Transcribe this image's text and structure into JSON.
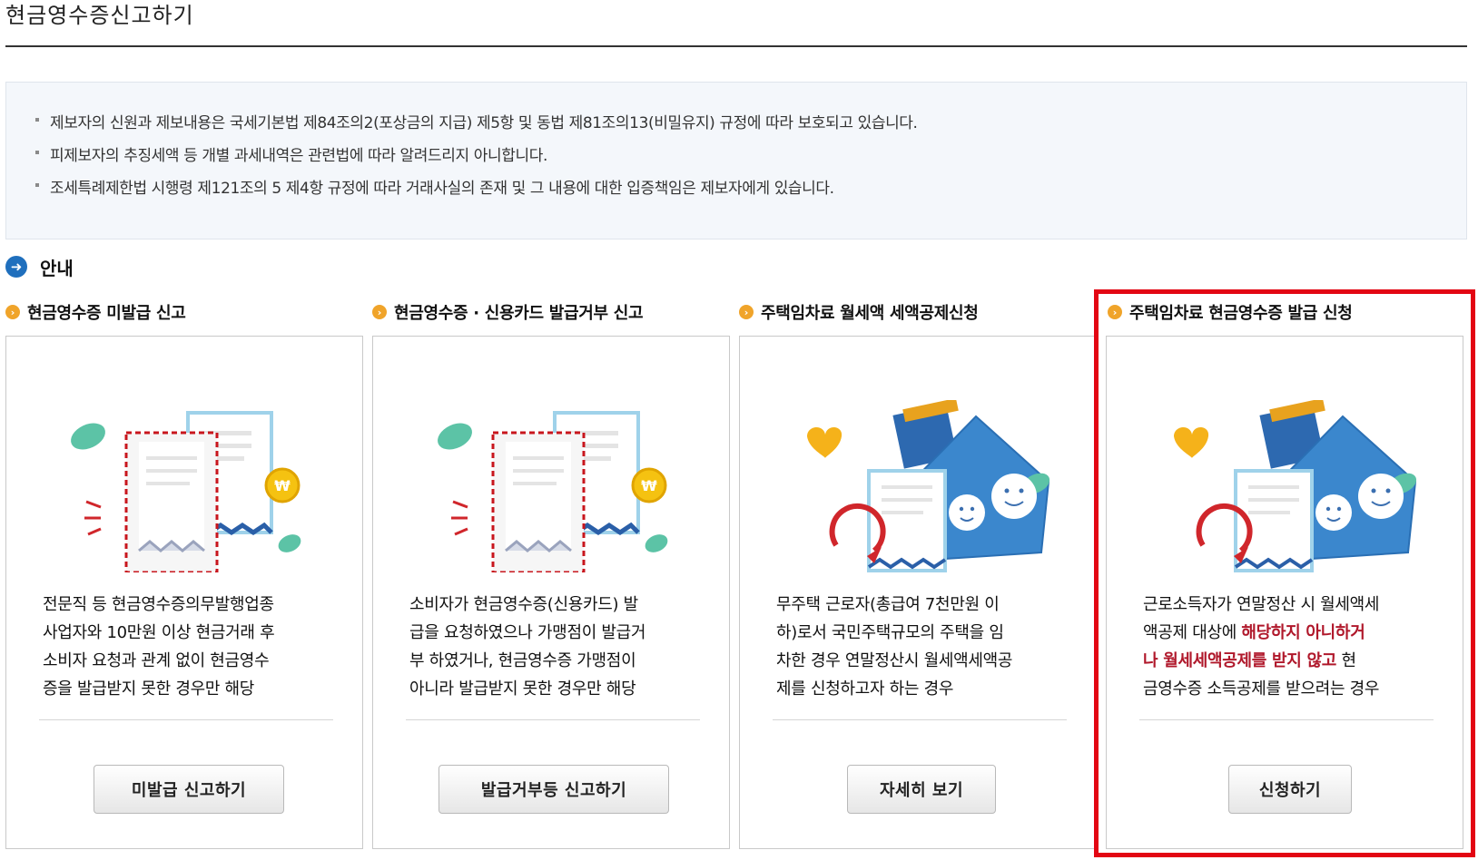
{
  "page": {
    "title": "현금영수증신고하기"
  },
  "notices": [
    "제보자의 신원과 제보내용은 국세기본법 제84조의2(포상금의 지급) 제5항 및 동법 제81조의13(비밀유지) 규정에 따라 보호되고 있습니다.",
    "피제보자의 추징세액 등 개별 과세내역은 관련법에 따라 알려드리지 아니합니다.",
    "조세특례제한법 시행령 제121조의 5 제4항 규정에 따라 거래사실의 존재 및 그 내용에 대한 입증책임은 제보자에게 있습니다."
  ],
  "section": {
    "title": "안내",
    "icon": "arrow-right-circle-icon"
  },
  "cards": [
    {
      "heading": "현금영수증 미발급 신고",
      "desc_lines": [
        "전문직 등 현금영수증의무발행업종",
        "사업자와 10만원 이상 현금거래 후",
        "소비자 요청과 관계 없이 현금영수",
        "증을 발급받지 못한 경우만 해당"
      ],
      "button": "미발급 신고하기",
      "illustration": "receipt-illustration"
    },
    {
      "heading": "현금영수증 · 신용카드 발급거부 신고",
      "desc_lines": [
        "소비자가 현금영수증(신용카드) 발",
        "급을 요청하였으나 가맹점이 발급거",
        "부 하였거나, 현금영수증 가맹점이",
        "아니라 발급받지 못한 경우만 해당"
      ],
      "button": "발급거부등 신고하기",
      "illustration": "receipt-illustration"
    },
    {
      "heading": "주택임차료 월세액 세액공제신청",
      "desc_lines": [
        "무주택 근로자(총급여 7천만원 이",
        "하)로서 국민주택규모의 주택을 임",
        "차한 경우 연말정산시 월세액세액공",
        "제를 신청하고자 하는 경우"
      ],
      "button": "자세히 보기",
      "illustration": "house-illustration"
    },
    {
      "heading": "주택임차료 현금영수증 발급 신청",
      "desc_parts": {
        "line1": "근로소득자가 연말정산 시 월세액세",
        "line2a": "액공제 대상에 ",
        "line2b": "해당하지 아니하거",
        "line3a": "나 월세세액공제를 받지 않고",
        "line3b": " 현",
        "line4": "금영수증 소득공제를 받으려는 경우"
      },
      "button": "신청하기",
      "illustration": "house-illustration"
    }
  ],
  "colors": {
    "highlight": "#e30613",
    "emphasis": "#b0182b",
    "section_icon": "#1f6fbd",
    "bullet_icon": "#f0a42a"
  }
}
